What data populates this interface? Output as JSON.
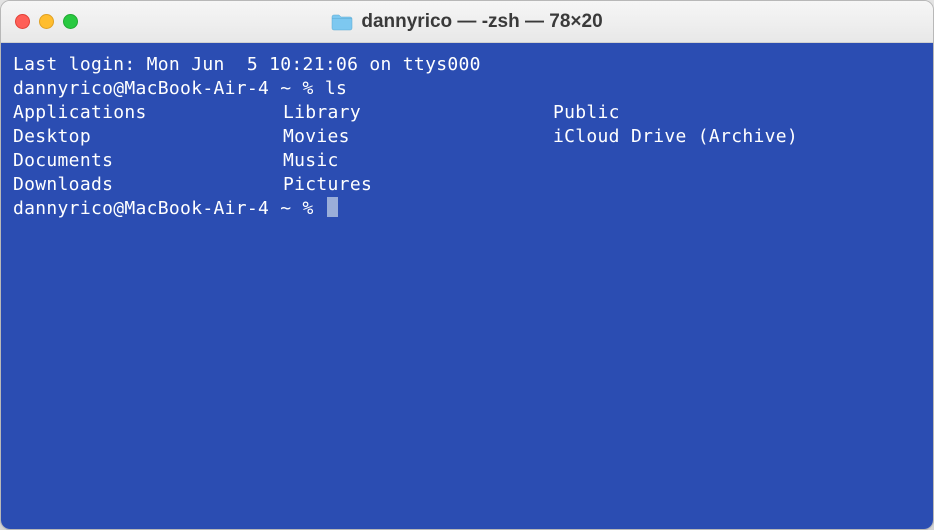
{
  "window": {
    "title": "dannyrico — -zsh — 78×20"
  },
  "terminal": {
    "last_login": "Last login: Mon Jun  5 10:21:06 on ttys000",
    "prompt1": "dannyrico@MacBook-Air-4 ~ % ",
    "command1": "ls",
    "ls_output": {
      "col1": [
        "Applications",
        "Desktop",
        "Documents",
        "Downloads"
      ],
      "col2": [
        "Library",
        "Movies",
        "Music",
        "Pictures"
      ],
      "col3": [
        "Public",
        "iCloud Drive (Archive)",
        "",
        ""
      ]
    },
    "prompt2": "dannyrico@MacBook-Air-4 ~ % "
  }
}
